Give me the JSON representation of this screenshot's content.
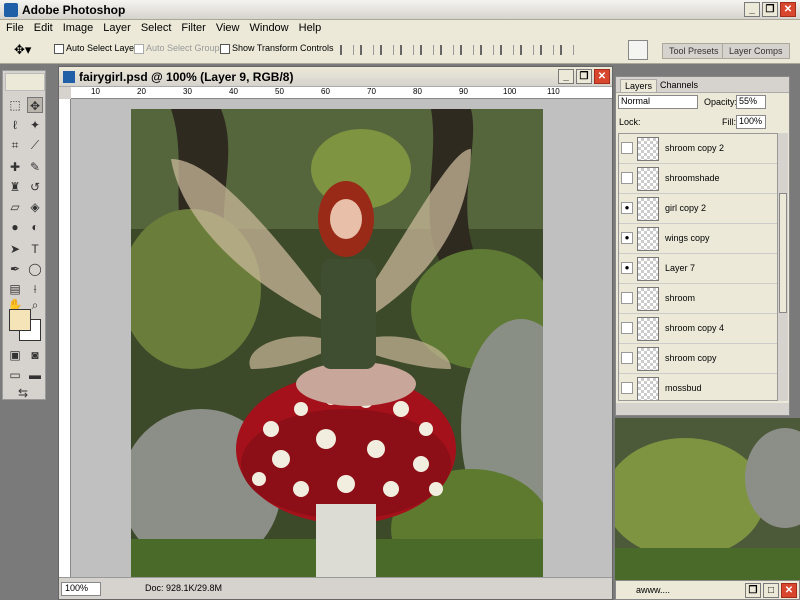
{
  "app": {
    "title": "Adobe Photoshop"
  },
  "menu": [
    "File",
    "Edit",
    "Image",
    "Layer",
    "Select",
    "Filter",
    "View",
    "Window",
    "Help"
  ],
  "options": {
    "auto_select_layer": "Auto Select Layer",
    "auto_select_groups": "Auto Select Groups",
    "show_transform_controls": "Show Transform Controls",
    "tool_presets": "Tool Presets",
    "layer_comps": "Layer Comps"
  },
  "document": {
    "title": "fairygirl.psd @ 100% (Layer 9, RGB/8)",
    "zoom": "100%",
    "doc_size": "Doc: 928.1K/29.8M",
    "ruler_h": [
      "10",
      "20",
      "30",
      "40",
      "50",
      "60",
      "70",
      "80",
      "90",
      "100",
      "110"
    ]
  },
  "layers_panel": {
    "tabs": [
      "Layers",
      "Channels"
    ],
    "blend_mode": "Normal",
    "opacity_label": "Opacity:",
    "opacity": "55%",
    "lock_label": "Lock:",
    "fill_label": "Fill:",
    "fill": "100%",
    "layers": [
      {
        "name": "shroom copy 2",
        "visible": false
      },
      {
        "name": "shroomshade",
        "visible": false
      },
      {
        "name": "girl copy 2",
        "visible": true
      },
      {
        "name": "wings copy",
        "visible": true
      },
      {
        "name": "Layer 7",
        "visible": true
      },
      {
        "name": "shroom",
        "visible": false
      },
      {
        "name": "shroom copy 4",
        "visible": false
      },
      {
        "name": "shroom copy",
        "visible": false
      },
      {
        "name": "mossbud",
        "visible": false
      }
    ]
  },
  "taskbar_window": {
    "label": "awww...."
  },
  "colors": {
    "foreground": "#f5e4b8",
    "background": "#ffffff"
  }
}
